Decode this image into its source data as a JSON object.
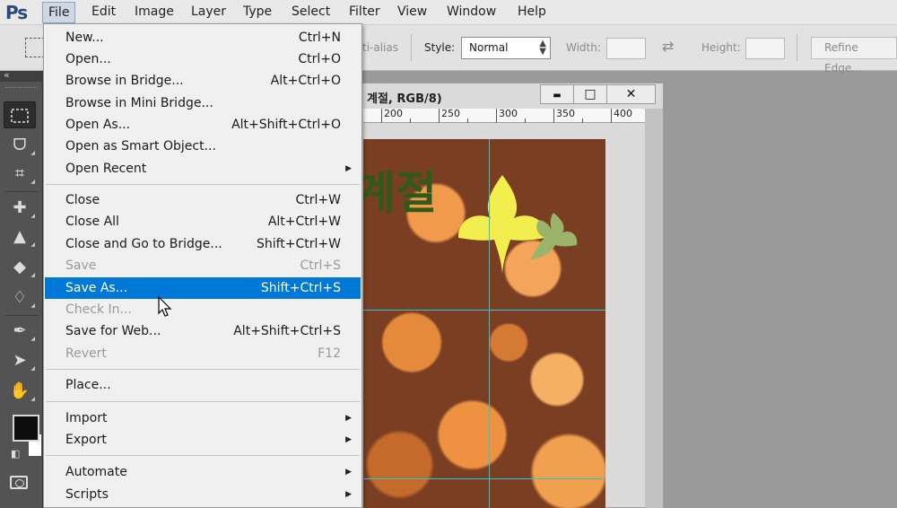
{
  "app": {
    "logo": "Ps"
  },
  "menubar": {
    "items": [
      "File",
      "Edit",
      "Image",
      "Layer",
      "Type",
      "Select",
      "Filter",
      "View",
      "Window",
      "Help"
    ],
    "active": "File"
  },
  "options_bar": {
    "antialias_label": "ti-alias",
    "style_label": "Style:",
    "style_value": "Normal",
    "width_label": "Width:",
    "height_label": "Height:",
    "refine_edge_label": "Refine Edge..."
  },
  "document": {
    "title": "계절, RGB/8)",
    "minimize_glyph": "▬",
    "maximize_glyph": "□",
    "close_glyph": "✕",
    "ruler_ticks": [
      "200",
      "250",
      "300",
      "350",
      "400"
    ],
    "canvas_text": "계절",
    "colors": {
      "yellow_leaf": "#f2ee4e",
      "green_leaf": "#9bb46a",
      "guide": "#29c7d8"
    }
  },
  "file_menu": {
    "items": [
      {
        "label": "New...",
        "shortcut": "Ctrl+N",
        "disabled": false
      },
      {
        "label": "Open...",
        "shortcut": "Ctrl+O",
        "disabled": false
      },
      {
        "label": "Browse in Bridge...",
        "shortcut": "Alt+Ctrl+O",
        "disabled": false
      },
      {
        "label": "Browse in Mini Bridge...",
        "shortcut": "",
        "disabled": false
      },
      {
        "label": "Open As...",
        "shortcut": "Alt+Shift+Ctrl+O",
        "disabled": false
      },
      {
        "label": "Open as Smart Object...",
        "shortcut": "",
        "disabled": false
      },
      {
        "label": "Open Recent",
        "shortcut": "",
        "submenu": true,
        "disabled": false
      },
      {
        "label": "Close",
        "shortcut": "Ctrl+W",
        "disabled": false
      },
      {
        "label": "Close All",
        "shortcut": "Alt+Ctrl+W",
        "disabled": false
      },
      {
        "label": "Close and Go to Bridge...",
        "shortcut": "Shift+Ctrl+W",
        "disabled": false
      },
      {
        "label": "Save",
        "shortcut": "Ctrl+S",
        "disabled": true
      },
      {
        "label": "Save As...",
        "shortcut": "Shift+Ctrl+S",
        "disabled": false,
        "highlighted": true
      },
      {
        "label": "Check In...",
        "shortcut": "",
        "disabled": true
      },
      {
        "label": "Save for Web...",
        "shortcut": "Alt+Shift+Ctrl+S",
        "disabled": false
      },
      {
        "label": "Revert",
        "shortcut": "F12",
        "disabled": true
      },
      {
        "label": "Place...",
        "shortcut": "",
        "disabled": false
      },
      {
        "label": "Import",
        "shortcut": "",
        "submenu": true,
        "disabled": false
      },
      {
        "label": "Export",
        "shortcut": "",
        "submenu": true,
        "disabled": false
      },
      {
        "label": "Automate",
        "shortcut": "",
        "submenu": true,
        "disabled": false
      },
      {
        "label": "Scripts",
        "shortcut": "",
        "submenu": true,
        "disabled": false
      }
    ]
  },
  "tools": [
    "rectangular-marquee-icon",
    "lasso-icon",
    "crop-icon",
    "healing-brush-icon",
    "clone-stamp-icon",
    "eraser-icon",
    "blur-icon",
    "pen-icon",
    "path-selection-icon",
    "hand-icon"
  ],
  "colors": {
    "highlight": "#0078d7",
    "foreground": "#0c0c0c",
    "background": "#ffffff"
  }
}
